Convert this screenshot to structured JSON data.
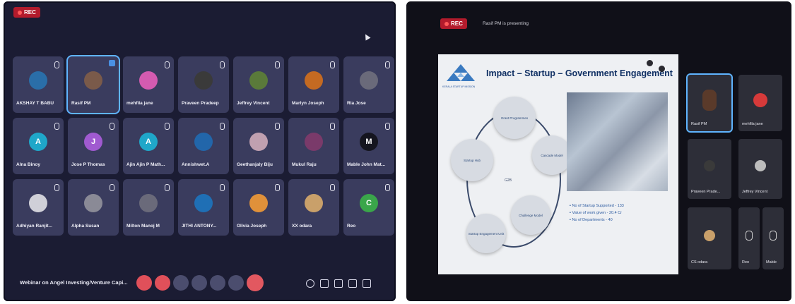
{
  "left_screen": {
    "rec_label": "REC",
    "participants": [
      {
        "name": "AKSHAY T BABU",
        "initial": "",
        "color": "#2a6ea8"
      },
      {
        "name": "Rasif PM",
        "initial": "",
        "color": "#7a5a4a"
      },
      {
        "name": "mehfila jane",
        "initial": "",
        "color": "#d45bb0"
      },
      {
        "name": "Praveen Pradeep",
        "initial": "",
        "color": "#3a3a3a"
      },
      {
        "name": "Jeffrey Vincent",
        "initial": "",
        "color": "#5a7a3a"
      },
      {
        "name": "Marlyn Joseph",
        "initial": "",
        "color": "#c46a22"
      },
      {
        "name": "Ria Jose",
        "initial": "",
        "color": "#6a6a7a"
      },
      {
        "name": "Alna Binoy",
        "initial": "A",
        "color": "#1fa7c9"
      },
      {
        "name": "Jose P Thomas",
        "initial": "J",
        "color": "#a05ad0"
      },
      {
        "name": "Ajin Ajin P Math...",
        "initial": "A",
        "color": "#1fa7c9"
      },
      {
        "name": "Annishwet.A",
        "initial": "",
        "color": "#2266aa"
      },
      {
        "name": "Geethanjaly Biju",
        "initial": "",
        "color": "#c0a0b0"
      },
      {
        "name": "Mukul Raju",
        "initial": "",
        "color": "#7a3a6a"
      },
      {
        "name": "Mable John Mat...",
        "initial": "M",
        "color": "#15151f"
      },
      {
        "name": "Adhiyan Ranjit...",
        "initial": "",
        "color": "#d0d0d8"
      },
      {
        "name": "Alpha Susan",
        "initial": "",
        "color": "#8a8a96"
      },
      {
        "name": "Milton Manoj M",
        "initial": "",
        "color": "#6a6a7a"
      },
      {
        "name": "JITHI ANTONY...",
        "initial": "",
        "color": "#1f6fb5"
      },
      {
        "name": "Olivia Joseph",
        "initial": "",
        "color": "#e0913a"
      },
      {
        "name": "XX odara",
        "initial": "",
        "color": "#c9a06a"
      },
      {
        "name": "Reo",
        "initial": "C",
        "color": "#3aa64a"
      }
    ],
    "webinar_title": "Webinar on Angel Investing/Venture Capi..."
  },
  "right_screen": {
    "rec_label": "REC",
    "presenting_text": "Rasif PM is presenting",
    "slide": {
      "logo_caption": "KERALA STARTUP MISSION",
      "title": "Impact – Startup – Government Engagement",
      "center_label": "G2B",
      "circles": [
        "Grant Programmes",
        "Cascade Model",
        "Challenge Model",
        "Startup Engagement Unit",
        "Startup Hub"
      ],
      "bullets": [
        "No of Startup Supported - 133",
        "Value of work given - 20.4 Cr",
        "No of Departments - 40"
      ]
    },
    "participants": [
      {
        "name": "Rasif PM"
      },
      {
        "name": "mehfila jane"
      },
      {
        "name": "Praveen Prade..."
      },
      {
        "name": "Jeffrey Vincent"
      },
      {
        "name": "CS odara"
      },
      {
        "name": "Reo"
      },
      {
        "name": "Mable"
      }
    ]
  },
  "colors": {
    "rec_red": "#b31b2c",
    "tile_bg": "#3a3c5e",
    "active_outline": "#5fb4ff",
    "slide_title": "#0f2f63"
  }
}
